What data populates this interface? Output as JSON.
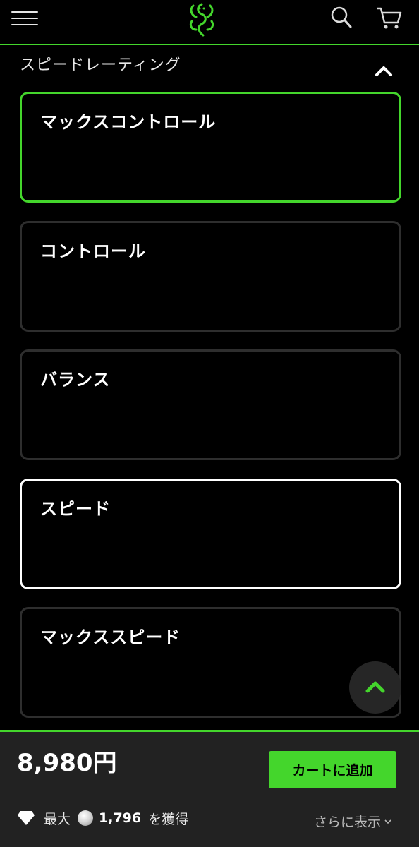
{
  "header": {
    "menu_icon": "hamburger-icon",
    "logo_icon": "razer-snake-logo-icon",
    "search_icon": "search-icon",
    "cart_icon": "cart-icon"
  },
  "section": {
    "title": "スピードレーティング",
    "toggle_icon": "chevron-up-icon"
  },
  "options": [
    {
      "label": "マックスコントロール",
      "state": "selected"
    },
    {
      "label": "コントロール",
      "state": "default"
    },
    {
      "label": "バランス",
      "state": "default"
    },
    {
      "label": "スピード",
      "state": "focused"
    },
    {
      "label": "マックススピード",
      "state": "default"
    }
  ],
  "colors": {
    "accent": "#44d62c",
    "background": "#000000",
    "bar_background": "#222222",
    "card_border": "#2e2e2e"
  },
  "purchase": {
    "price": "8,980円",
    "add_to_cart": "カートに追加",
    "rewards_prefix": "最大",
    "rewards_amount": "1,796",
    "rewards_suffix": "を獲得",
    "show_more": "さらに表示"
  }
}
